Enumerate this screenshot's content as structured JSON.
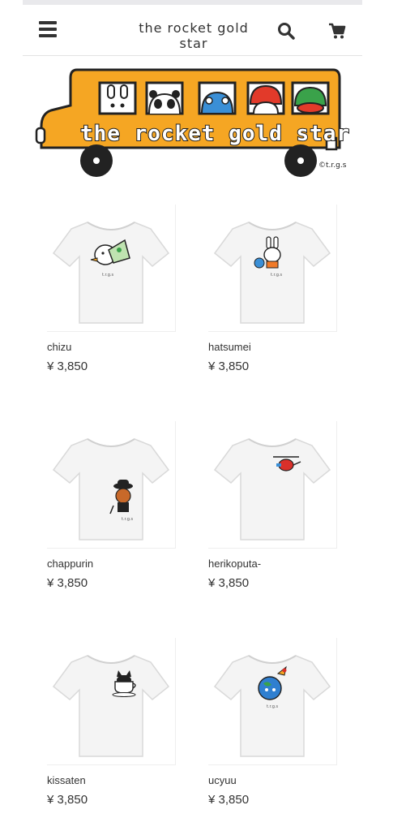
{
  "header": {
    "store_name": "the rocket gold star",
    "menu_icon": "hamburger-menu-icon",
    "search_icon": "search-icon",
    "cart_icon": "shopping-cart-icon"
  },
  "banner": {
    "alt": "the rocket gold star bus logo",
    "logo_text": "the rocket gold star",
    "copyright": "©t.r.g.s",
    "colors": {
      "bus": "#f5a623",
      "outline": "#222222"
    }
  },
  "products": [
    {
      "name": "chizu",
      "price": "¥ 3,850",
      "print": "bird-with-map"
    },
    {
      "name": "hatsumei",
      "price": "¥ 3,850",
      "print": "rabbit-with-lightbulb"
    },
    {
      "name": "chappurin",
      "price": "¥ 3,850",
      "print": "bear-in-bowler-hat"
    },
    {
      "name": "herikoputa-",
      "price": "¥ 3,850",
      "print": "red-helicopter"
    },
    {
      "name": "kissaten",
      "price": "¥ 3,850",
      "print": "cat-in-coffee-cup"
    },
    {
      "name": "ucyuu",
      "price": "¥ 3,850",
      "print": "blue-earth-with-rocket"
    }
  ]
}
